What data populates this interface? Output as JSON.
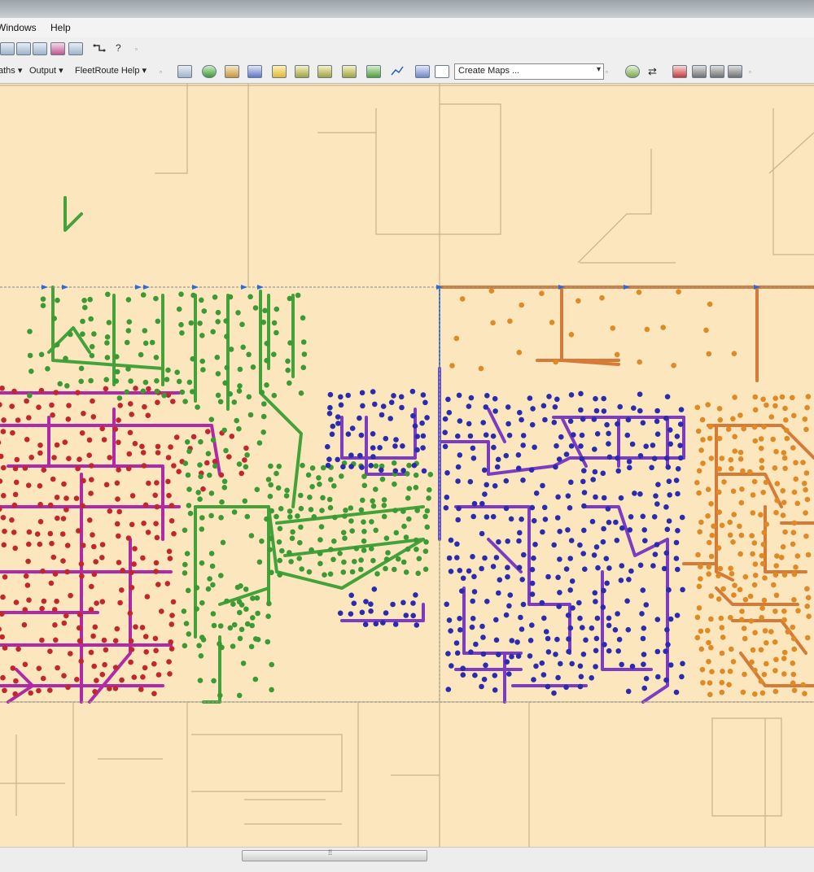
{
  "menubar": {
    "items": [
      {
        "label": "Windows"
      },
      {
        "label": "Help"
      }
    ]
  },
  "toolbar2": {
    "menus": [
      {
        "label": "aths ▾"
      },
      {
        "label": "Output ▾"
      },
      {
        "label": "FleetRoute Help ▾"
      }
    ],
    "create_maps": {
      "value": "Create Maps ..."
    }
  },
  "map": {
    "background": "#fbe6bd",
    "street_color": "#c9b28c",
    "zones": [
      {
        "name": "red",
        "color": "#c0282d",
        "route_color": "#b02aa8"
      },
      {
        "name": "green",
        "color": "#3c9a34",
        "route_color": "#43a23a"
      },
      {
        "name": "blue",
        "color": "#2b2bb0",
        "route_color": "#7b3cc2"
      },
      {
        "name": "orange",
        "color": "#e08a25",
        "route_color": "#d67a38"
      }
    ]
  },
  "colors": {
    "accent_blue": "#2d6bd6",
    "grid_gray": "#9a9a9a"
  }
}
